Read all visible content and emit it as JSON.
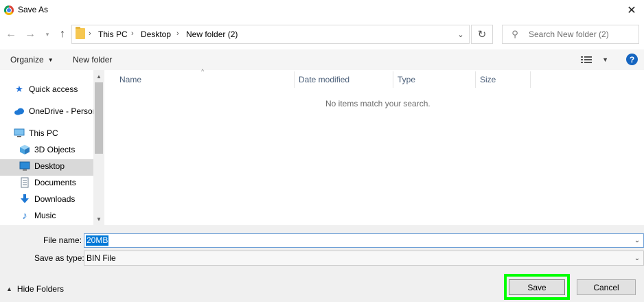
{
  "window": {
    "title": "Save As",
    "close_label": "✕"
  },
  "nav": {
    "back_icon": "arrow-left-icon",
    "forward_icon": "arrow-right-icon",
    "up_icon": "arrow-up-icon",
    "breadcrumbs": [
      "This PC",
      "Desktop",
      "New folder (2)"
    ],
    "refresh_icon": "refresh-icon"
  },
  "search": {
    "placeholder": "Search New folder (2)"
  },
  "toolbar": {
    "organize_label": "Organize",
    "new_folder_label": "New folder",
    "help_label": "?"
  },
  "sidebar": {
    "items": [
      {
        "label": "Quick access",
        "icon": "star-icon"
      },
      {
        "label": "OneDrive - Persor",
        "icon": "cloud-icon"
      },
      {
        "label": "This PC",
        "icon": "computer-icon"
      },
      {
        "label": "3D Objects",
        "icon": "cube-icon"
      },
      {
        "label": "Desktop",
        "icon": "desktop-icon",
        "selected": true
      },
      {
        "label": "Documents",
        "icon": "document-icon"
      },
      {
        "label": "Downloads",
        "icon": "download-icon"
      },
      {
        "label": "Music",
        "icon": "music-icon"
      }
    ]
  },
  "file_list": {
    "columns": [
      "Name",
      "Date modified",
      "Type",
      "Size"
    ],
    "empty_message": "No items match your search."
  },
  "form": {
    "file_name_label": "File name:",
    "file_name_value": "20MB",
    "save_as_type_label": "Save as type:",
    "save_as_type_value": "BIN File"
  },
  "footer": {
    "hide_folders_label": "Hide Folders",
    "save_label": "Save",
    "cancel_label": "Cancel"
  },
  "colors": {
    "highlight": "#00ff00",
    "selection": "#0078d7",
    "help": "#1565c0"
  }
}
